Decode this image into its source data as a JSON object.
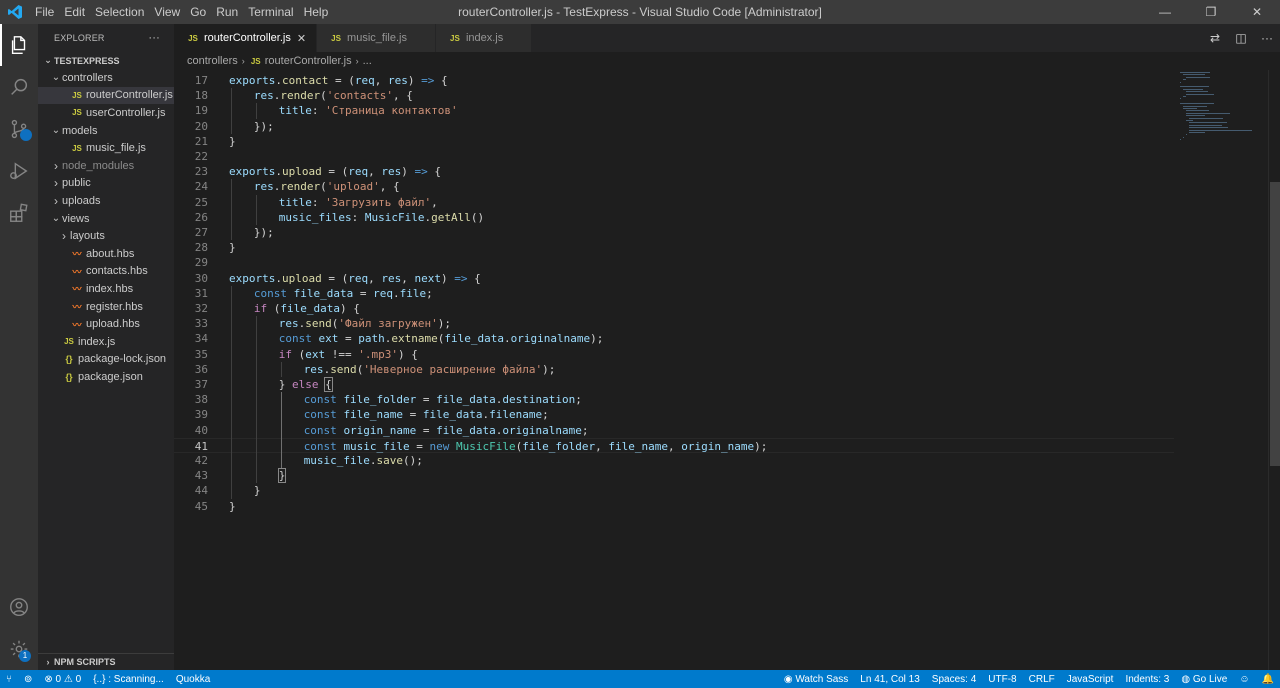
{
  "window": {
    "title": "routerController.js - TestExpress - Visual Studio Code [Administrator]",
    "menu": [
      "File",
      "Edit",
      "Selection",
      "View",
      "Go",
      "Run",
      "Terminal",
      "Help"
    ],
    "controls": {
      "minimize": "—",
      "restore": "❐",
      "close": "✕"
    }
  },
  "activity_bar": {
    "icons": [
      "files-icon",
      "search-icon",
      "source-control-icon",
      "run-debug-icon",
      "extensions-icon"
    ],
    "bottom_icons": [
      "account-icon",
      "manage-gear-icon"
    ],
    "gear_badge": "1"
  },
  "sidebar": {
    "header": "EXPLORER",
    "more": "···",
    "project": "TESTEXPRESS",
    "tree": [
      {
        "label": "controllers",
        "type": "folder",
        "open": true,
        "indent": 1
      },
      {
        "label": "routerController.js",
        "type": "js",
        "indent": 2,
        "selected": true
      },
      {
        "label": "userController.js",
        "type": "js",
        "indent": 2
      },
      {
        "label": "models",
        "type": "folder",
        "open": true,
        "indent": 1
      },
      {
        "label": "music_file.js",
        "type": "js",
        "indent": 2
      },
      {
        "label": "node_modules",
        "type": "folder",
        "open": false,
        "indent": 1,
        "dim": true
      },
      {
        "label": "public",
        "type": "folder",
        "open": false,
        "indent": 1
      },
      {
        "label": "uploads",
        "type": "folder",
        "open": false,
        "indent": 1
      },
      {
        "label": "views",
        "type": "folder",
        "open": true,
        "indent": 1
      },
      {
        "label": "layouts",
        "type": "folder",
        "open": false,
        "indent": 2
      },
      {
        "label": "about.hbs",
        "type": "hbs",
        "indent": 2
      },
      {
        "label": "contacts.hbs",
        "type": "hbs",
        "indent": 2
      },
      {
        "label": "index.hbs",
        "type": "hbs",
        "indent": 2
      },
      {
        "label": "register.hbs",
        "type": "hbs",
        "indent": 2
      },
      {
        "label": "upload.hbs",
        "type": "hbs",
        "indent": 2
      },
      {
        "label": "index.js",
        "type": "js",
        "indent": 1
      },
      {
        "label": "package-lock.json",
        "type": "json",
        "indent": 1
      },
      {
        "label": "package.json",
        "type": "json",
        "indent": 1
      }
    ],
    "npm_scripts": "NPM SCRIPTS"
  },
  "tabs": [
    {
      "label": "routerController.js",
      "active": true
    },
    {
      "label": "music_file.js",
      "active": false
    },
    {
      "label": "index.js",
      "active": false
    }
  ],
  "breadcrumb": {
    "folder": "controllers",
    "file": "routerController.js",
    "symbol": "..."
  },
  "editor": {
    "current_line": 41,
    "lines": [
      {
        "n": 17,
        "indent": 0,
        "tokens": [
          [
            "v",
            "exports"
          ],
          [
            "p",
            "."
          ],
          [
            "f",
            "contact"
          ],
          [
            "p",
            " = ("
          ],
          [
            "v",
            "req"
          ],
          [
            "p",
            ", "
          ],
          [
            "v",
            "res"
          ],
          [
            "p",
            ") "
          ],
          [
            "k",
            "=>"
          ],
          [
            "p",
            " {"
          ]
        ]
      },
      {
        "n": 18,
        "indent": 1,
        "tokens": [
          [
            "v",
            "res"
          ],
          [
            "p",
            "."
          ],
          [
            "f",
            "render"
          ],
          [
            "p",
            "("
          ],
          [
            "s",
            "'contacts'"
          ],
          [
            "p",
            ", {"
          ]
        ]
      },
      {
        "n": 19,
        "indent": 2,
        "tokens": [
          [
            "v",
            "title"
          ],
          [
            "p",
            ": "
          ],
          [
            "s",
            "'Страница контактов'"
          ]
        ]
      },
      {
        "n": 20,
        "indent": 1,
        "tokens": [
          [
            "p",
            "});"
          ]
        ]
      },
      {
        "n": 21,
        "indent": 0,
        "tokens": [
          [
            "p",
            "}"
          ]
        ]
      },
      {
        "n": 22,
        "indent": 0,
        "tokens": []
      },
      {
        "n": 23,
        "indent": 0,
        "tokens": [
          [
            "v",
            "exports"
          ],
          [
            "p",
            "."
          ],
          [
            "f",
            "upload"
          ],
          [
            "p",
            " = ("
          ],
          [
            "v",
            "req"
          ],
          [
            "p",
            ", "
          ],
          [
            "v",
            "res"
          ],
          [
            "p",
            ") "
          ],
          [
            "k",
            "=>"
          ],
          [
            "p",
            " {"
          ]
        ]
      },
      {
        "n": 24,
        "indent": 1,
        "tokens": [
          [
            "v",
            "res"
          ],
          [
            "p",
            "."
          ],
          [
            "f",
            "render"
          ],
          [
            "p",
            "("
          ],
          [
            "s",
            "'upload'"
          ],
          [
            "p",
            ", {"
          ]
        ]
      },
      {
        "n": 25,
        "indent": 2,
        "tokens": [
          [
            "v",
            "title"
          ],
          [
            "p",
            ": "
          ],
          [
            "s",
            "'Загрузить файл'"
          ],
          [
            "p",
            ","
          ]
        ]
      },
      {
        "n": 26,
        "indent": 2,
        "tokens": [
          [
            "v",
            "music_files"
          ],
          [
            "p",
            ": "
          ],
          [
            "v",
            "MusicFile"
          ],
          [
            "p",
            "."
          ],
          [
            "f",
            "getAll"
          ],
          [
            "p",
            "()"
          ]
        ]
      },
      {
        "n": 27,
        "indent": 1,
        "tokens": [
          [
            "p",
            "});"
          ]
        ]
      },
      {
        "n": 28,
        "indent": 0,
        "tokens": [
          [
            "p",
            "}"
          ]
        ]
      },
      {
        "n": 29,
        "indent": 0,
        "tokens": []
      },
      {
        "n": 30,
        "indent": 0,
        "tokens": [
          [
            "v",
            "exports"
          ],
          [
            "p",
            "."
          ],
          [
            "f",
            "upload"
          ],
          [
            "p",
            " = ("
          ],
          [
            "v",
            "req"
          ],
          [
            "p",
            ", "
          ],
          [
            "v",
            "res"
          ],
          [
            "p",
            ", "
          ],
          [
            "v",
            "next"
          ],
          [
            "p",
            ") "
          ],
          [
            "k",
            "=>"
          ],
          [
            "p",
            " {"
          ]
        ]
      },
      {
        "n": 31,
        "indent": 1,
        "tokens": [
          [
            "k",
            "const"
          ],
          [
            "p",
            " "
          ],
          [
            "v",
            "file_data"
          ],
          [
            "p",
            " = "
          ],
          [
            "v",
            "req"
          ],
          [
            "p",
            "."
          ],
          [
            "v",
            "file"
          ],
          [
            "p",
            ";"
          ]
        ]
      },
      {
        "n": 32,
        "indent": 1,
        "tokens": [
          [
            "c",
            "if"
          ],
          [
            "p",
            " ("
          ],
          [
            "v",
            "file_data"
          ],
          [
            "p",
            ") {"
          ]
        ]
      },
      {
        "n": 33,
        "indent": 2,
        "tokens": [
          [
            "v",
            "res"
          ],
          [
            "p",
            "."
          ],
          [
            "f",
            "send"
          ],
          [
            "p",
            "("
          ],
          [
            "s",
            "'Файл загружен'"
          ],
          [
            "p",
            ");"
          ]
        ]
      },
      {
        "n": 34,
        "indent": 2,
        "tokens": [
          [
            "k",
            "const"
          ],
          [
            "p",
            " "
          ],
          [
            "v",
            "ext"
          ],
          [
            "p",
            " = "
          ],
          [
            "v",
            "path"
          ],
          [
            "p",
            "."
          ],
          [
            "f",
            "extname"
          ],
          [
            "p",
            "("
          ],
          [
            "v",
            "file_data"
          ],
          [
            "p",
            "."
          ],
          [
            "v",
            "originalname"
          ],
          [
            "p",
            ");"
          ]
        ]
      },
      {
        "n": 35,
        "indent": 2,
        "tokens": [
          [
            "c",
            "if"
          ],
          [
            "p",
            " ("
          ],
          [
            "v",
            "ext"
          ],
          [
            "p",
            " !== "
          ],
          [
            "s",
            "'.mp3'"
          ],
          [
            "p",
            ") {"
          ]
        ]
      },
      {
        "n": 36,
        "indent": 3,
        "tokens": [
          [
            "v",
            "res"
          ],
          [
            "p",
            "."
          ],
          [
            "f",
            "send"
          ],
          [
            "p",
            "("
          ],
          [
            "s",
            "'Неверное расширение файла'"
          ],
          [
            "p",
            ");"
          ]
        ]
      },
      {
        "n": 37,
        "indent": 2,
        "tokens": [
          [
            "p",
            "} "
          ],
          [
            "c",
            "else"
          ],
          [
            "p",
            " "
          ],
          [
            "b",
            "{"
          ]
        ]
      },
      {
        "n": 38,
        "indent": 3,
        "tokens": [
          [
            "k",
            "const"
          ],
          [
            "p",
            " "
          ],
          [
            "v",
            "file_folder"
          ],
          [
            "p",
            " = "
          ],
          [
            "v",
            "file_data"
          ],
          [
            "p",
            "."
          ],
          [
            "v",
            "destination"
          ],
          [
            "p",
            ";"
          ]
        ]
      },
      {
        "n": 39,
        "indent": 3,
        "tokens": [
          [
            "k",
            "const"
          ],
          [
            "p",
            " "
          ],
          [
            "v",
            "file_name"
          ],
          [
            "p",
            " = "
          ],
          [
            "v",
            "file_data"
          ],
          [
            "p",
            "."
          ],
          [
            "v",
            "filename"
          ],
          [
            "p",
            ";"
          ]
        ]
      },
      {
        "n": 40,
        "indent": 3,
        "tokens": [
          [
            "k",
            "const"
          ],
          [
            "p",
            " "
          ],
          [
            "v",
            "origin_name"
          ],
          [
            "p",
            " = "
          ],
          [
            "v",
            "file_data"
          ],
          [
            "p",
            "."
          ],
          [
            "v",
            "originalname"
          ],
          [
            "p",
            ";"
          ]
        ]
      },
      {
        "n": 41,
        "indent": 3,
        "tokens": [
          [
            "k",
            "const"
          ],
          [
            "p",
            " "
          ],
          [
            "v",
            "music_file"
          ],
          [
            "p",
            " = "
          ],
          [
            "k",
            "new"
          ],
          [
            "p",
            " "
          ],
          [
            "t",
            "MusicFile"
          ],
          [
            "p",
            "("
          ],
          [
            "v",
            "file_folder"
          ],
          [
            "p",
            ", "
          ],
          [
            "v",
            "file_name"
          ],
          [
            "p",
            ", "
          ],
          [
            "v",
            "origin_name"
          ],
          [
            "p",
            ");"
          ]
        ]
      },
      {
        "n": 42,
        "indent": 3,
        "tokens": [
          [
            "v",
            "music_file"
          ],
          [
            "p",
            "."
          ],
          [
            "f",
            "save"
          ],
          [
            "p",
            "();"
          ]
        ]
      },
      {
        "n": 43,
        "indent": 2,
        "tokens": [
          [
            "b",
            "}"
          ]
        ]
      },
      {
        "n": 44,
        "indent": 1,
        "tokens": [
          [
            "p",
            "}"
          ]
        ]
      },
      {
        "n": 45,
        "indent": 0,
        "tokens": [
          [
            "p",
            "}"
          ]
        ]
      }
    ]
  },
  "statusbar": {
    "left": [
      {
        "name": "remote-indicator",
        "text": "⑂"
      },
      {
        "name": "live-share",
        "text": "⊚"
      },
      {
        "name": "problems",
        "text": "⊗ 0  ⚠ 0"
      },
      {
        "name": "scanning",
        "text": "{..} : Scanning..."
      },
      {
        "name": "quokka",
        "text": "Quokka"
      }
    ],
    "right": [
      {
        "name": "watch-sass",
        "text": "◉ Watch Sass"
      },
      {
        "name": "cursor-position",
        "text": "Ln 41, Col 13"
      },
      {
        "name": "indentation",
        "text": "Spaces: 4"
      },
      {
        "name": "encoding",
        "text": "UTF-8"
      },
      {
        "name": "line-ending",
        "text": "CRLF"
      },
      {
        "name": "language-mode",
        "text": "JavaScript"
      },
      {
        "name": "indents-ext",
        "text": "Indents: 3"
      },
      {
        "name": "go-live",
        "text": "◍ Go Live"
      },
      {
        "name": "feedback",
        "text": "☺"
      },
      {
        "name": "notifications",
        "text": "🔔"
      }
    ]
  }
}
